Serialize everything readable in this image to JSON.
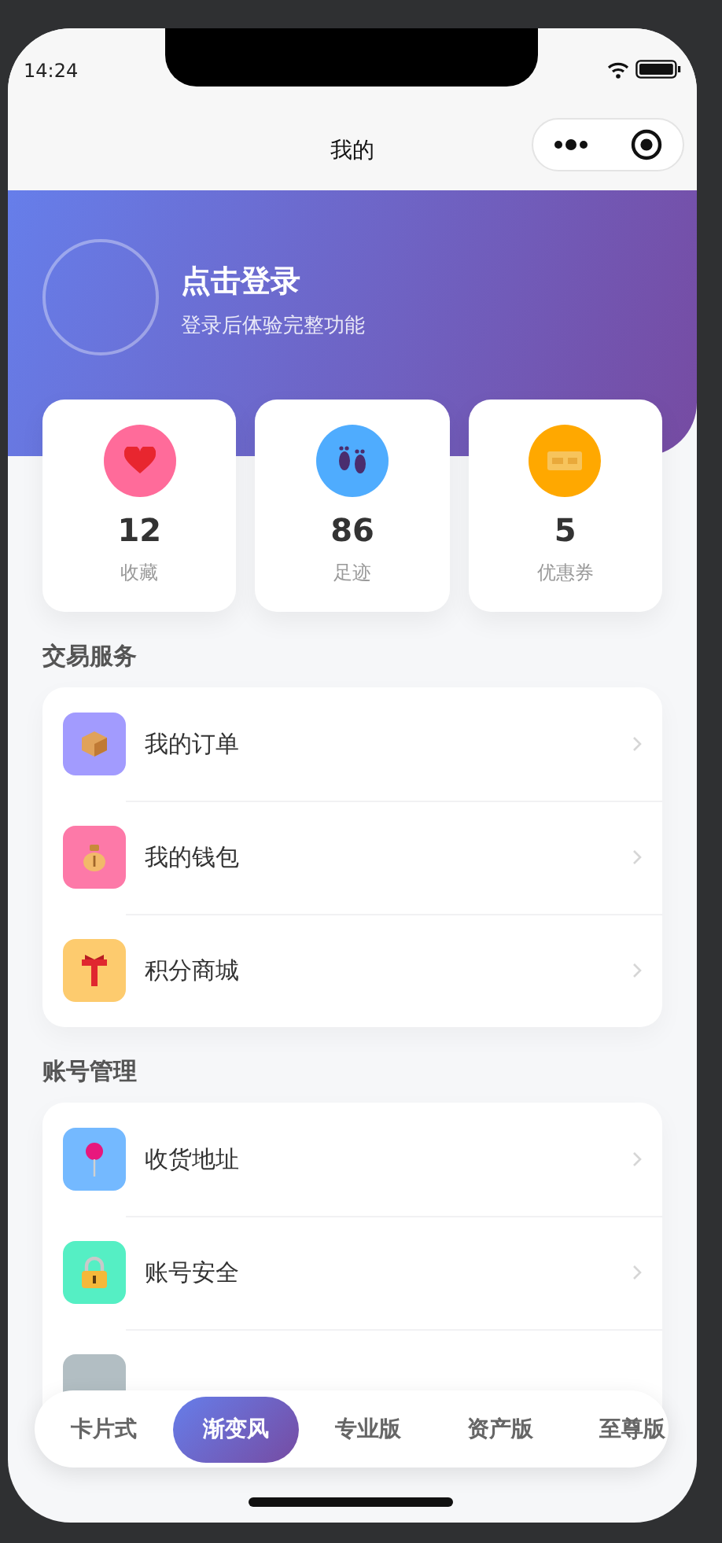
{
  "status_bar": {
    "time": "14:24"
  },
  "nav": {
    "title": "我的"
  },
  "profile": {
    "title": "点击登录",
    "subtitle": "登录后体验完整功能"
  },
  "stats": [
    {
      "value": "12",
      "label": "收藏",
      "color": "#ff6b9a",
      "kind": "heart"
    },
    {
      "value": "86",
      "label": "足迹",
      "color": "#4facfe",
      "kind": "feet"
    },
    {
      "value": "5",
      "label": "优惠券",
      "color": "#ffa800",
      "kind": "ticket"
    }
  ],
  "sections": [
    {
      "title": "交易服务",
      "items": [
        {
          "label": "我的订单",
          "color": "#a29bfe",
          "kind": "box"
        },
        {
          "label": "我的钱包",
          "color": "#fd79a8",
          "kind": "bag"
        },
        {
          "label": "积分商城",
          "color": "#fdcb6e",
          "kind": "gift"
        }
      ]
    },
    {
      "title": "账号管理",
      "items": [
        {
          "label": "收货地址",
          "color": "#74b9ff",
          "kind": "pin"
        },
        {
          "label": "账号安全",
          "color": "#55efc4",
          "kind": "lock"
        },
        {
          "color": "#b2bec3",
          "kind": "blank"
        }
      ]
    }
  ],
  "tabs": [
    {
      "label": "卡片式",
      "selected": false
    },
    {
      "label": "渐变风",
      "selected": true
    },
    {
      "label": "专业版",
      "selected": false
    },
    {
      "label": "资产版",
      "selected": false
    },
    {
      "label": "至尊版",
      "selected": false
    }
  ]
}
